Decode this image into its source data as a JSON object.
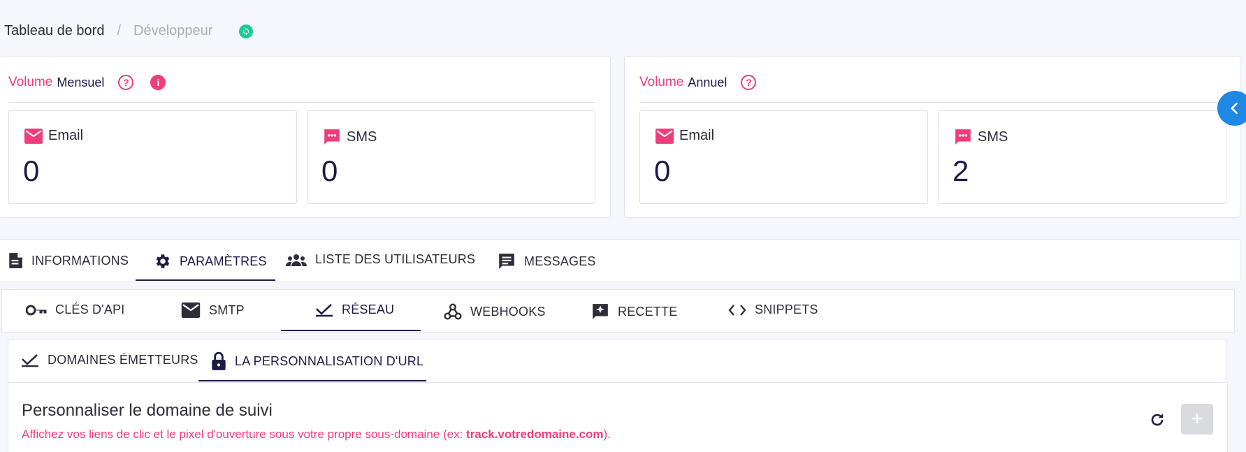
{
  "breadcrumb": {
    "home": "Tableau de bord",
    "separator": "/",
    "current": "Développeur"
  },
  "monthly": {
    "title_a": "Volume",
    "title_b": "Mensuel",
    "email_label": "Email",
    "email_value": "0",
    "sms_label": "SMS",
    "sms_value": "0"
  },
  "annual": {
    "title_a": "Volume",
    "title_b": "Annuel",
    "email_label": "Email",
    "email_value": "0",
    "sms_label": "SMS",
    "sms_value": "2"
  },
  "main_tabs": [
    {
      "label": "INFORMATIONS",
      "icon": "document-icon"
    },
    {
      "label": "PARAMÈTRES",
      "icon": "gear-icon",
      "active": true
    },
    {
      "label": "LISTE DES UTILISATEURS",
      "icon": "users-icon"
    },
    {
      "label": "MESSAGES",
      "icon": "message-icon"
    }
  ],
  "sub_tabs": [
    {
      "label": "CLÉS D'API",
      "icon": "key-icon"
    },
    {
      "label": "SMTP",
      "icon": "mail-icon"
    },
    {
      "label": "RÉSEAU",
      "icon": "network-icon",
      "active": true
    },
    {
      "label": "WEBHOOKS",
      "icon": "webhook-icon"
    },
    {
      "label": "RECETTE",
      "icon": "sparkle-chat-icon"
    },
    {
      "label": "SNIPPETS",
      "icon": "code-icon"
    }
  ],
  "network_tabs": [
    {
      "label": "DOMAINES ÉMETTEURS",
      "icon": "network-icon"
    },
    {
      "label": "LA PERSONNALISATION D'URL",
      "icon": "lock-icon",
      "active": true
    }
  ],
  "section": {
    "title": "Personnaliser le domaine de suivi",
    "desc_before": "Affichez vos liens de clic et le pixel d'ouverture sous votre propre sous-domaine (ex: ",
    "desc_bold": "track.votredomaine.com",
    "desc_after": ")."
  },
  "add_symbol": "+",
  "colors": {
    "accent": "#f03c7a",
    "navy": "#1b1b46",
    "blue": "#1e88e5",
    "green": "#20c997"
  }
}
